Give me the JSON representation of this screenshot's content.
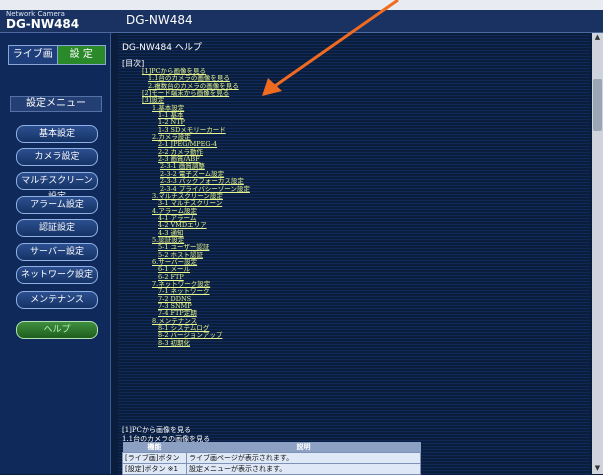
{
  "header": {
    "brand_small": "Network Camera",
    "brand_model": "DG-NW484",
    "title": "DG-NW484"
  },
  "mode_tabs": {
    "live": "ライブ画",
    "setup": "設 定"
  },
  "menu": {
    "title": "設定メニュー",
    "items": [
      "基本設定",
      "カメラ設定",
      "マルチスクリーン設定",
      "アラーム設定",
      "認証設定",
      "サーバー設定",
      "ネットワーク設定",
      "メンテナンス"
    ],
    "help": "ヘルプ"
  },
  "content": {
    "heading": "DG-NW484 ヘルプ",
    "toc_label": "[目次]",
    "toc": [
      "[1]PCから画像を見る",
      "1.1台のカメラの画像を見る",
      "2.複数台のカメラの画像を見る",
      "[2]モード端末から画像を見る",
      "[3]設定",
      "1.基本設定",
      "1-1 基本",
      "1-2 NTP",
      "1-3 SDメモリーカード",
      "2.カメラ設定",
      "2-1 JPEG/MPEG-4",
      "2-2 カメラ動作",
      "2-3 画質/ABF",
      "2-3-1 画質調整",
      "2-3-2 電子ズーム設定",
      "2-3-3 バックフォーカス設定",
      "2-3-4 プライバシーゾーン設定",
      "3.マルチスクリーン設定",
      "3-1 マルチスクリーン",
      "4.アラーム設定",
      "4-1 アラーム",
      "4-2 VMDエリア",
      "4-3 通知",
      "5.認証設定",
      "5-1 ユーザー認証",
      "5-2 ホスト認証",
      "6.サーバー設定",
      "6-1 メール",
      "6-2 FTP",
      "7.ネットワーク設定",
      "7-1 ネットワーク",
      "7-2 DDNS",
      "7-3 SNMP",
      "7-4 FTP定期",
      "8.メンテナンス",
      "8-1 システムログ",
      "8-2 バージョンアップ",
      "8-3 初期化"
    ],
    "section_title": "[1]PCから画像を見る",
    "section_sub": "1.1台のカメラの画像を見る",
    "table": {
      "headers": [
        "機能",
        "説明"
      ],
      "rows": [
        [
          "[ライブ画]ボタン",
          "ライブ画ページが表示されます。"
        ],
        [
          "[設定]ボタン ※1",
          "設定メニューが表示されます。"
        ]
      ]
    }
  },
  "colors": {
    "accent_link": "#e6f58c",
    "setup_green": "#2a8a2a",
    "arrow": "#f06a20"
  }
}
